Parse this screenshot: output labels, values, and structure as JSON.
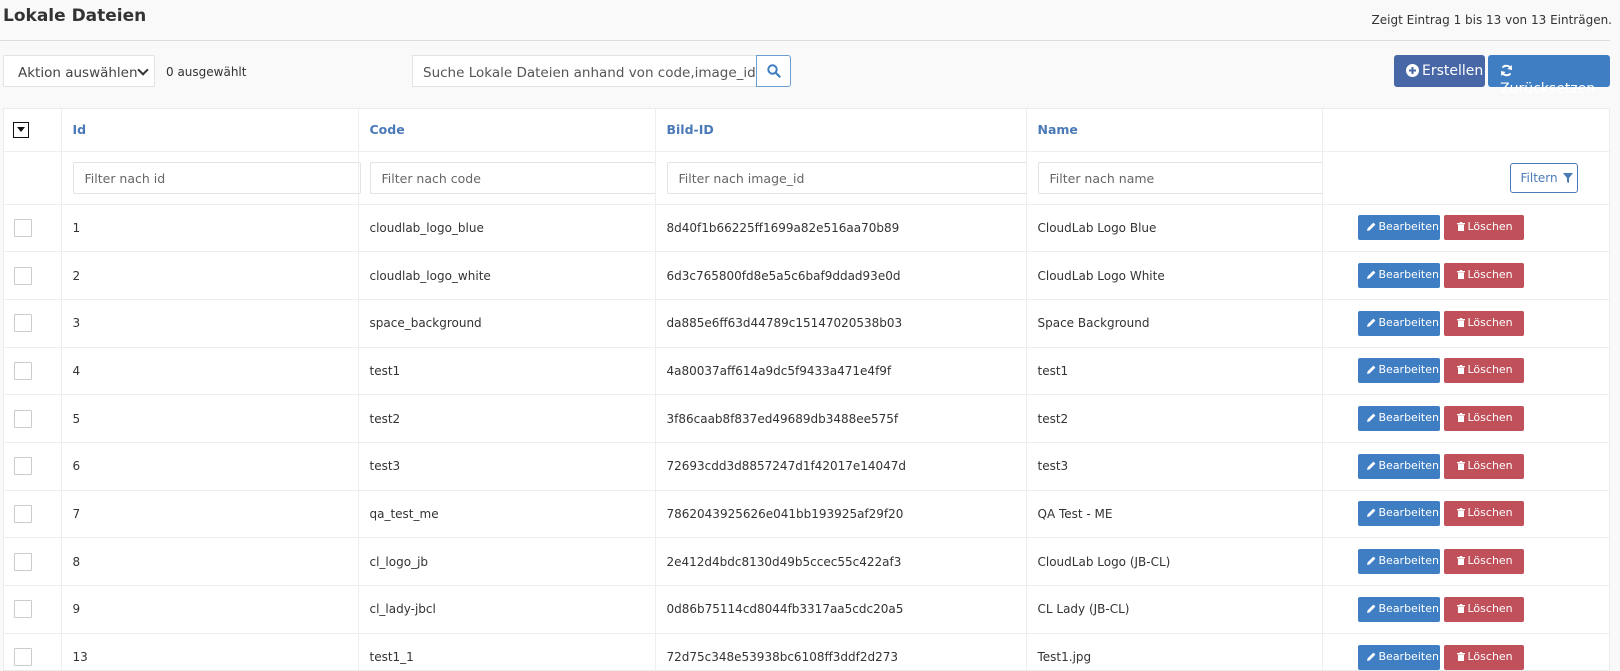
{
  "header": {
    "title": "Lokale Dateien",
    "entries_info": "Zeigt Eintrag 1 bis 13 von 13 Einträgen."
  },
  "toolbar": {
    "action_select": "Aktion auswählen",
    "selected_count": "0 ausgewählt",
    "search_placeholder": "Suche Lokale Dateien anhand von code,image_id,name",
    "create_label": "Erstellen",
    "reset_label": "Zurücksetzen"
  },
  "table": {
    "columns": [
      "Id",
      "Code",
      "Bild-ID",
      "Name"
    ],
    "filters": [
      "Filter nach id",
      "Filter nach code",
      "Filter nach image_id",
      "Filter nach name"
    ],
    "filter_button": "Filtern",
    "edit_label": "Bearbeiten",
    "delete_label": "Löschen",
    "rows": [
      {
        "id": "1",
        "code": "cloudlab_logo_blue",
        "image_id": "8d40f1b66225ff1699a82e516aa70b89",
        "name": "CloudLab Logo Blue"
      },
      {
        "id": "2",
        "code": "cloudlab_logo_white",
        "image_id": "6d3c765800fd8e5a5c6baf9ddad93e0d",
        "name": "CloudLab Logo White"
      },
      {
        "id": "3",
        "code": "space_background",
        "image_id": "da885e6ff63d44789c15147020538b03",
        "name": "Space Background"
      },
      {
        "id": "4",
        "code": "test1",
        "image_id": "4a80037aff614a9dc5f9433a471e4f9f",
        "name": "test1"
      },
      {
        "id": "5",
        "code": "test2",
        "image_id": "3f86caab8f837ed49689db3488ee575f",
        "name": "test2"
      },
      {
        "id": "6",
        "code": "test3",
        "image_id": "72693cdd3d8857247d1f42017e14047d",
        "name": "test3"
      },
      {
        "id": "7",
        "code": "qa_test_me",
        "image_id": "7862043925626e041bb193925af29f20",
        "name": "QA Test - ME"
      },
      {
        "id": "8",
        "code": "cl_logo_jb",
        "image_id": "2e412d4bdc8130d49b5ccec55c422af3",
        "name": "CloudLab Logo (JB-CL)"
      },
      {
        "id": "9",
        "code": "cl_lady-jbcl",
        "image_id": "0d86b75114cd8044fb3317aa5cdc20a5",
        "name": "CL Lady (JB-CL)"
      },
      {
        "id": "13",
        "code": "test1_1",
        "image_id": "72d75c348e53938bc6108ff3ddf2d273",
        "name": "Test1.jpg"
      }
    ]
  },
  "colors": {
    "primary": "#3f7ec3",
    "create": "#4867a6",
    "danger": "#c0505a",
    "link": "#4a7ab7"
  }
}
